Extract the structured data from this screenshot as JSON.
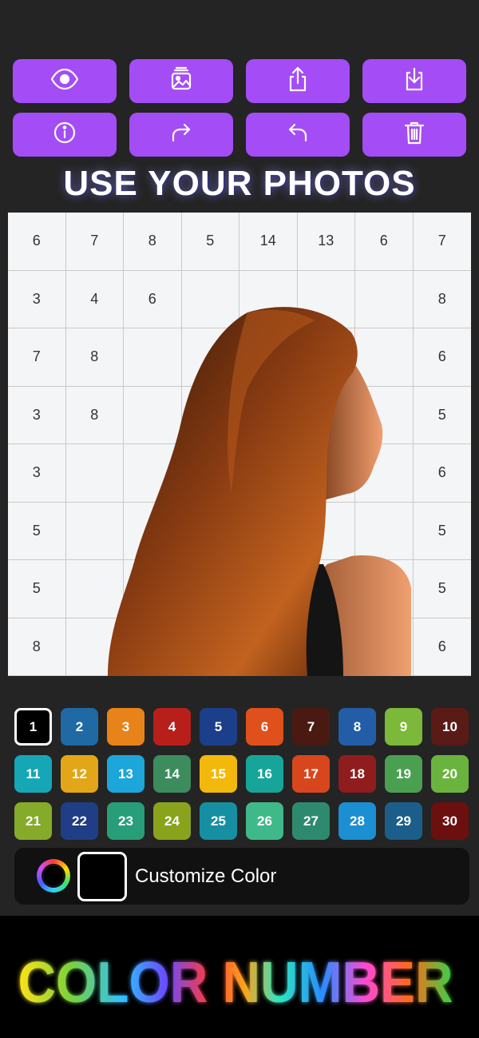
{
  "toolbar": {
    "buttons": [
      {
        "name": "preview-button",
        "icon": "eye-icon"
      },
      {
        "name": "gallery-button",
        "icon": "image-stack-icon"
      },
      {
        "name": "share-button",
        "icon": "share-icon"
      },
      {
        "name": "download-button",
        "icon": "download-icon"
      },
      {
        "name": "info-button",
        "icon": "info-icon"
      },
      {
        "name": "redo-button",
        "icon": "redo-icon"
      },
      {
        "name": "undo-button",
        "icon": "undo-icon"
      },
      {
        "name": "delete-button",
        "icon": "trash-icon"
      }
    ],
    "accent": "#a44cf5"
  },
  "headline": "USE YOUR PHOTOS",
  "board": {
    "rows": [
      [
        "6",
        "7",
        "8",
        "5",
        "14",
        "13",
        "6",
        "7"
      ],
      [
        "3",
        "4",
        "6",
        "",
        "",
        "",
        "",
        "8"
      ],
      [
        "7",
        "8",
        "",
        "",
        "",
        "",
        "",
        "6"
      ],
      [
        "3",
        "8",
        "",
        "",
        "",
        "",
        "",
        "5"
      ],
      [
        "3",
        "",
        "",
        "",
        "",
        "",
        "",
        "6"
      ],
      [
        "5",
        "",
        "",
        "",
        "",
        "",
        "",
        "5"
      ],
      [
        "5",
        "",
        "",
        "",
        "",
        "",
        "",
        "5"
      ],
      [
        "8",
        "",
        "",
        "",
        "",
        "",
        "",
        "6"
      ]
    ]
  },
  "palette": {
    "selected": "1",
    "swatches": [
      {
        "label": "1",
        "color": "#000000"
      },
      {
        "label": "2",
        "color": "#1f6aa5"
      },
      {
        "label": "3",
        "color": "#e8831a"
      },
      {
        "label": "4",
        "color": "#b81f1a"
      },
      {
        "label": "5",
        "color": "#1b3f8a"
      },
      {
        "label": "6",
        "color": "#e0501c"
      },
      {
        "label": "7",
        "color": "#4a1a12"
      },
      {
        "label": "8",
        "color": "#235da8"
      },
      {
        "label": "9",
        "color": "#7cb83a"
      },
      {
        "label": "10",
        "color": "#5a1a16"
      },
      {
        "label": "11",
        "color": "#16a7b6"
      },
      {
        "label": "12",
        "color": "#e2a618"
      },
      {
        "label": "13",
        "color": "#1ca6d9"
      },
      {
        "label": "14",
        "color": "#3d8c5e"
      },
      {
        "label": "15",
        "color": "#f2b90c"
      },
      {
        "label": "16",
        "color": "#17a59a"
      },
      {
        "label": "17",
        "color": "#d8461e"
      },
      {
        "label": "18",
        "color": "#8f1d1d"
      },
      {
        "label": "19",
        "color": "#4aa050"
      },
      {
        "label": "20",
        "color": "#6bb33f"
      },
      {
        "label": "21",
        "color": "#86ab2a"
      },
      {
        "label": "22",
        "color": "#1f3e86"
      },
      {
        "label": "23",
        "color": "#279e78"
      },
      {
        "label": "24",
        "color": "#8aa31c"
      },
      {
        "label": "25",
        "color": "#168fa2"
      },
      {
        "label": "26",
        "color": "#40b98a"
      },
      {
        "label": "27",
        "color": "#2e8a6e"
      },
      {
        "label": "28",
        "color": "#1b8fd2"
      },
      {
        "label": "29",
        "color": "#1c5e8a"
      },
      {
        "label": "30",
        "color": "#6b0f0f"
      }
    ]
  },
  "customize": {
    "label": "Customize Color",
    "current_color": "#000000"
  },
  "footer": {
    "title": "COLOR NUMBER"
  }
}
